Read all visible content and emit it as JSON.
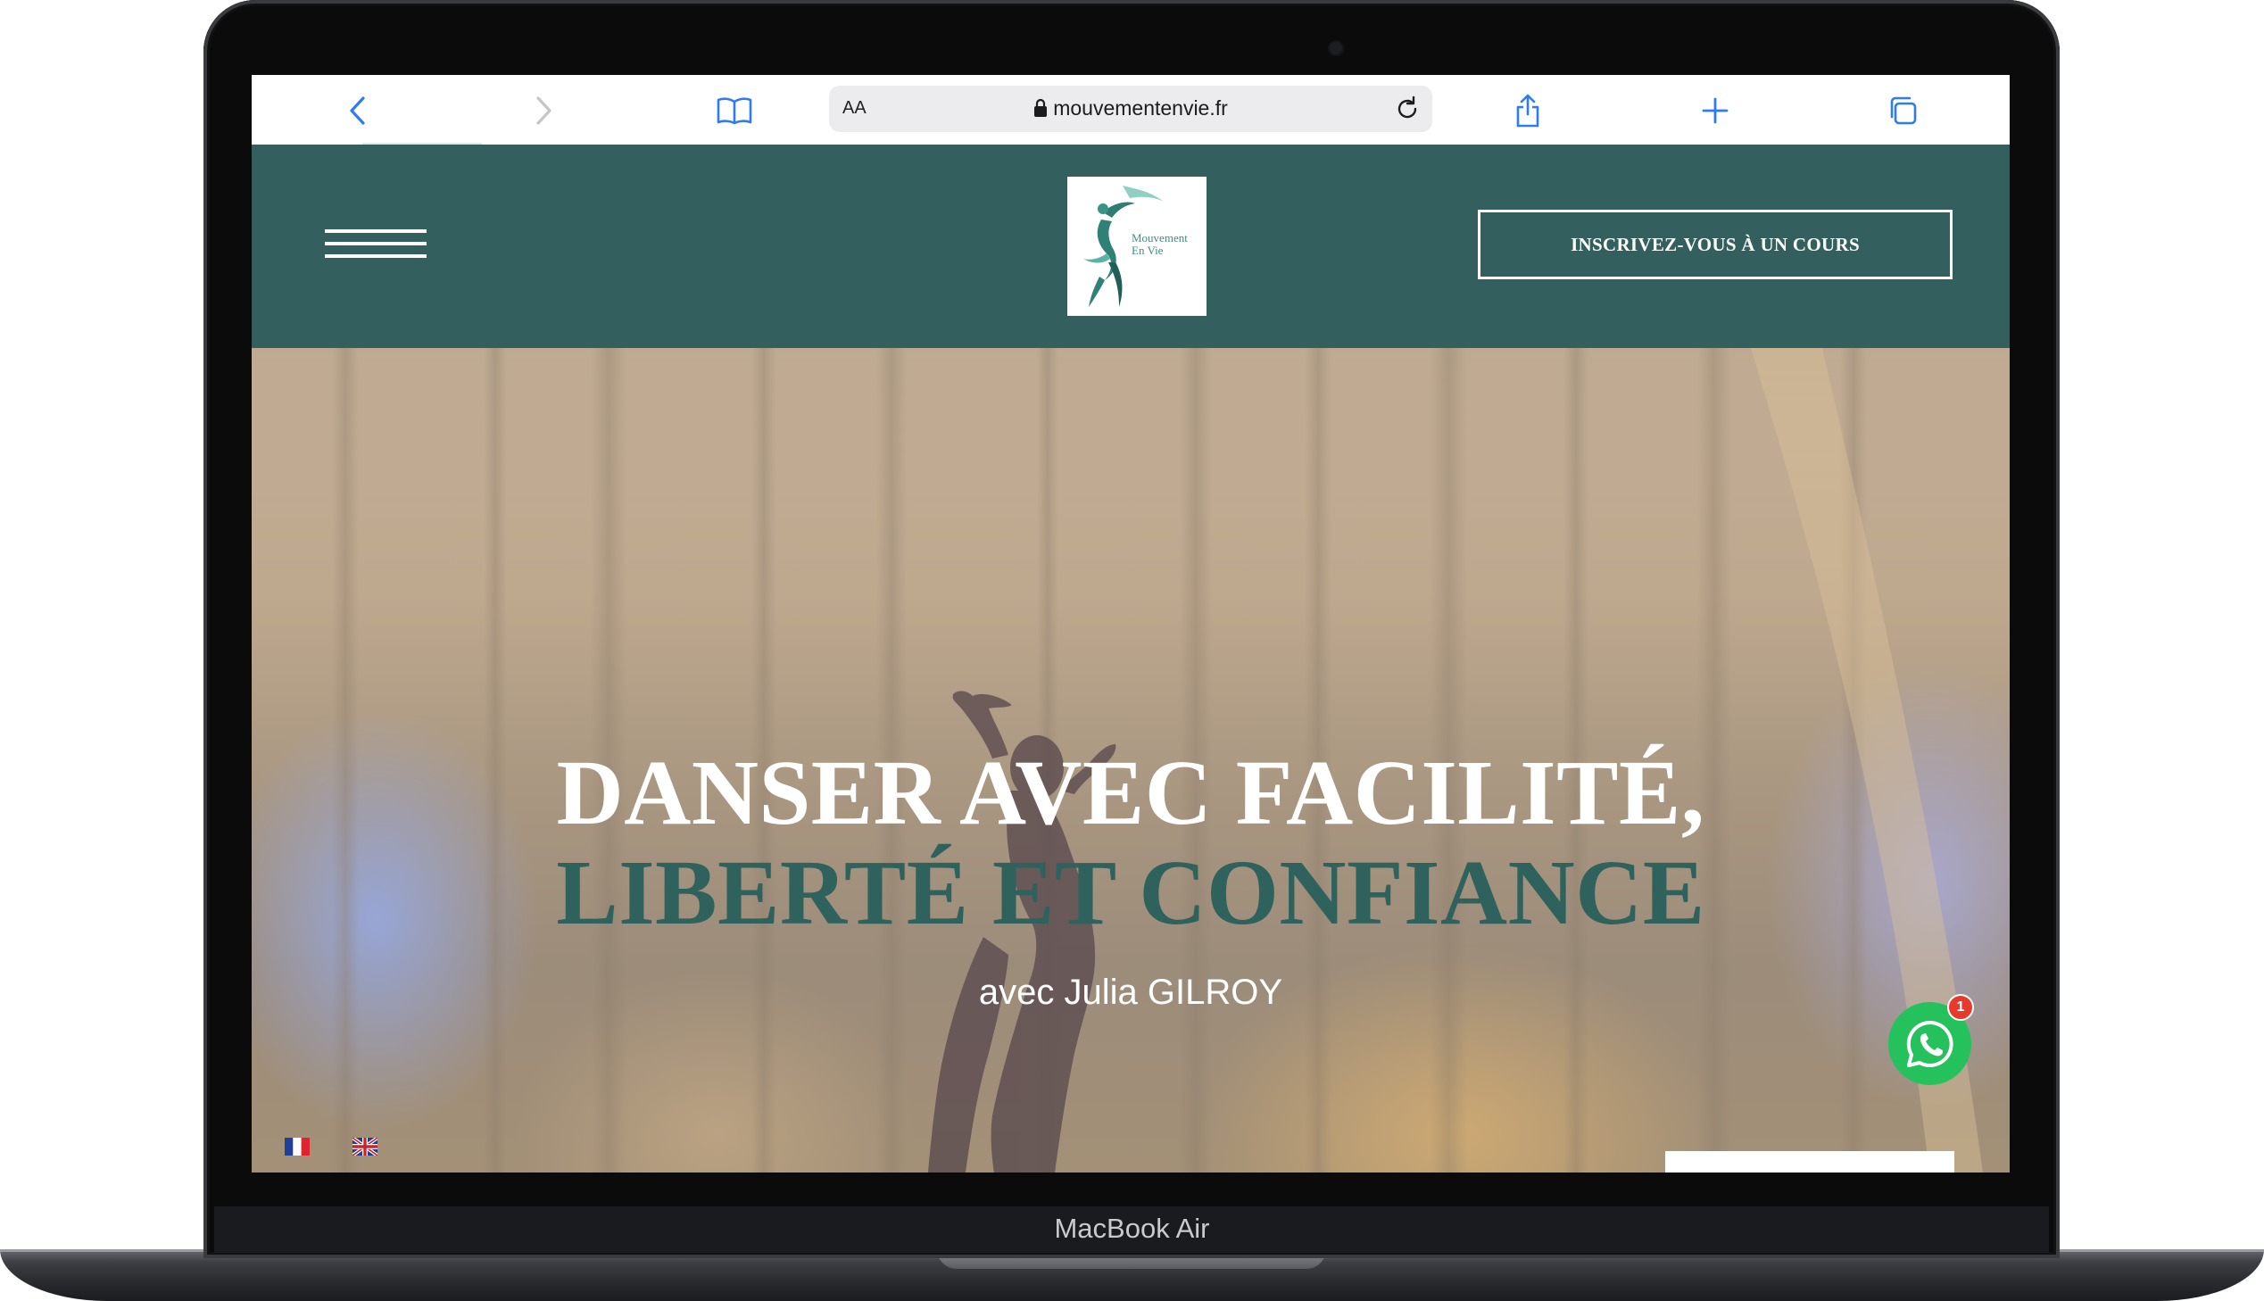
{
  "device": {
    "label": "MacBook Air"
  },
  "browser": {
    "text_size_control": "AA",
    "url": "mouvementenvie.fr",
    "icons": {
      "back": "chevron-left-icon",
      "forward": "chevron-right-icon",
      "bookmarks": "book-icon",
      "lock": "lock-icon",
      "reload": "reload-icon",
      "share": "share-icon",
      "new_tab": "plus-icon",
      "tabs": "tabs-icon"
    },
    "accent_color": "#2f7bf5"
  },
  "site": {
    "header_color": "#335f5f",
    "logo": {
      "line1": "Mouvement",
      "line2": "En Vie"
    },
    "cta_label": "INSCRIVEZ-VOUS À UN COURS"
  },
  "hero": {
    "title_line1": "DANSER AVEC FACILITÉ,",
    "title_line2": "LIBERTÉ ET CONFIANCE",
    "title_line2_color": "#2f625d",
    "subtitle": "avec Julia GILROY"
  },
  "languages": [
    {
      "code": "fr",
      "icon": "flag-france-icon"
    },
    {
      "code": "en",
      "icon": "flag-uk-icon"
    }
  ],
  "whatsapp": {
    "icon": "whatsapp-icon",
    "badge_count": "1",
    "color": "#25c15d"
  }
}
